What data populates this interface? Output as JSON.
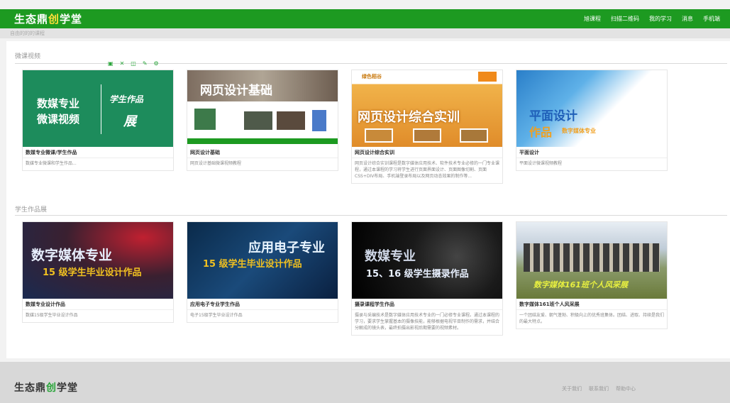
{
  "header": {
    "logo_pre": "生态鼎",
    "logo_mid": "创",
    "logo_post": "学堂",
    "nav": [
      "旭课程",
      "扫描二维码",
      "我的学习",
      "消息",
      "手机端"
    ]
  },
  "subbar": {
    "text": "自由的的的课程"
  },
  "section_micro": {
    "title": "微课视频"
  },
  "section_works": {
    "title": "学生作品展"
  },
  "toolbar_icons": [
    "photo-icon",
    "share-icon",
    "copy-icon",
    "edit-icon",
    "settings-icon"
  ],
  "colors": {
    "brand_green": "#1d9a21",
    "logo_accent": "#ffdf3a",
    "footer_bg": "#d8d8d8"
  },
  "cards_row1": [
    {
      "title": "数媒专业微课/学生作品",
      "desc": "数媒专业微课和学生作品...",
      "thumb_a": "数媒专业",
      "thumb_b": "微课视频",
      "thumb_c": "学生作品",
      "thumb_d": "展"
    },
    {
      "title": "网页设计基础",
      "desc": "网页设计基础微课视频教程",
      "thumb_a": "网页设计基础"
    },
    {
      "title": "网页设计综合实训",
      "desc": "网页设计综合实训课程是数字媒体应用技术、软件技术专业必修的一门专业课程，通过本课程的学习将学生进行页面界面设计、页面图像切割、页面CSS+DIV布局、手机端登录布局以及网页动态效果的制作等...",
      "thumb_a": "网页设计综合实训",
      "thumb_b": "绿色稻谷"
    },
    {
      "title": "平面设计",
      "desc": "平面设计微课视频教程",
      "thumb_a": "平面设计",
      "thumb_b": "作品",
      "thumb_c": "数字媒体专业"
    }
  ],
  "cards_row2": [
    {
      "title": "数媒专业设计作品",
      "desc": "数媒15级学生毕业设计作品",
      "thumb_a": "数字媒体专业",
      "thumb_b": "15 级学生毕业设计作品"
    },
    {
      "title": "应用电子专业学生作品",
      "desc": "电子15级学生毕业设计作品",
      "thumb_a": "应用电子专业",
      "thumb_b": "15 级学生毕业设计作品"
    },
    {
      "title": "摄录课程学生作品",
      "desc": "摄录与采编技术是数字媒体应用技术专业的一门必修专业课程。通过本课程的学习，要求学生掌握基本的摄像技能，能够根据电视节目制作的需求，并结合分解成的镜头表，最终拍摄出影视后期需要的视频素材。",
      "thumb_a": "数媒专业",
      "thumb_b": "15、16 级学生摄录作品"
    },
    {
      "title": "数字媒体161班个人风采展",
      "desc": "一个团结友爱、朝气蓬勃、积极向上的优秀班集体。团结、进取、持续是我们的最大特点。",
      "thumb_a": "数字媒体161班个人风采展"
    }
  ],
  "footer": {
    "logo_pre": "生态鼎",
    "logo_mid": "创",
    "logo_post": "学堂",
    "links": [
      "关于我们",
      "联系我们",
      "帮助中心"
    ]
  }
}
